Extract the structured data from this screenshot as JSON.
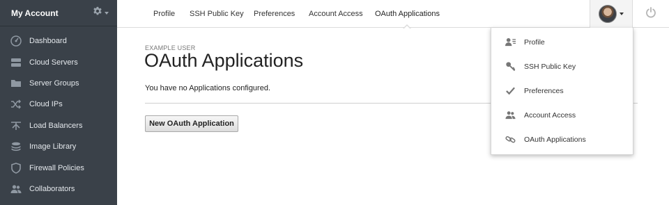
{
  "sidebar": {
    "title": "My Account",
    "items": [
      {
        "label": "Dashboard",
        "icon": "dashboard-icon"
      },
      {
        "label": "Cloud Servers",
        "icon": "servers-icon"
      },
      {
        "label": "Server Groups",
        "icon": "folder-icon"
      },
      {
        "label": "Cloud IPs",
        "icon": "shuffle-icon"
      },
      {
        "label": "Load Balancers",
        "icon": "load-balancer-icon"
      },
      {
        "label": "Image Library",
        "icon": "stack-icon"
      },
      {
        "label": "Firewall Policies",
        "icon": "shield-icon"
      },
      {
        "label": "Collaborators",
        "icon": "users-icon"
      }
    ]
  },
  "topnav": {
    "tabs": [
      {
        "label": "Profile"
      },
      {
        "label": "SSH Public Key"
      },
      {
        "label": "Preferences"
      },
      {
        "label": "Account Access"
      },
      {
        "label": "OAuth Applications",
        "active": true
      }
    ]
  },
  "main": {
    "eyebrow": "EXAMPLE USER",
    "title": "OAuth Applications",
    "empty_message": "You have no Applications configured.",
    "new_button": "New OAuth Application"
  },
  "user_menu": {
    "items": [
      {
        "label": "Profile",
        "icon": "profile-card-icon"
      },
      {
        "label": "SSH Public Key",
        "icon": "key-icon"
      },
      {
        "label": "Preferences",
        "icon": "checkmark-icon"
      },
      {
        "label": "Account Access",
        "icon": "users-icon"
      },
      {
        "label": "OAuth Applications",
        "icon": "link-icon"
      }
    ]
  },
  "colors": {
    "sidebar_bg": "#3a4149",
    "sidebar_text": "#e4e8ec",
    "button_border": "#a9a9a9"
  }
}
